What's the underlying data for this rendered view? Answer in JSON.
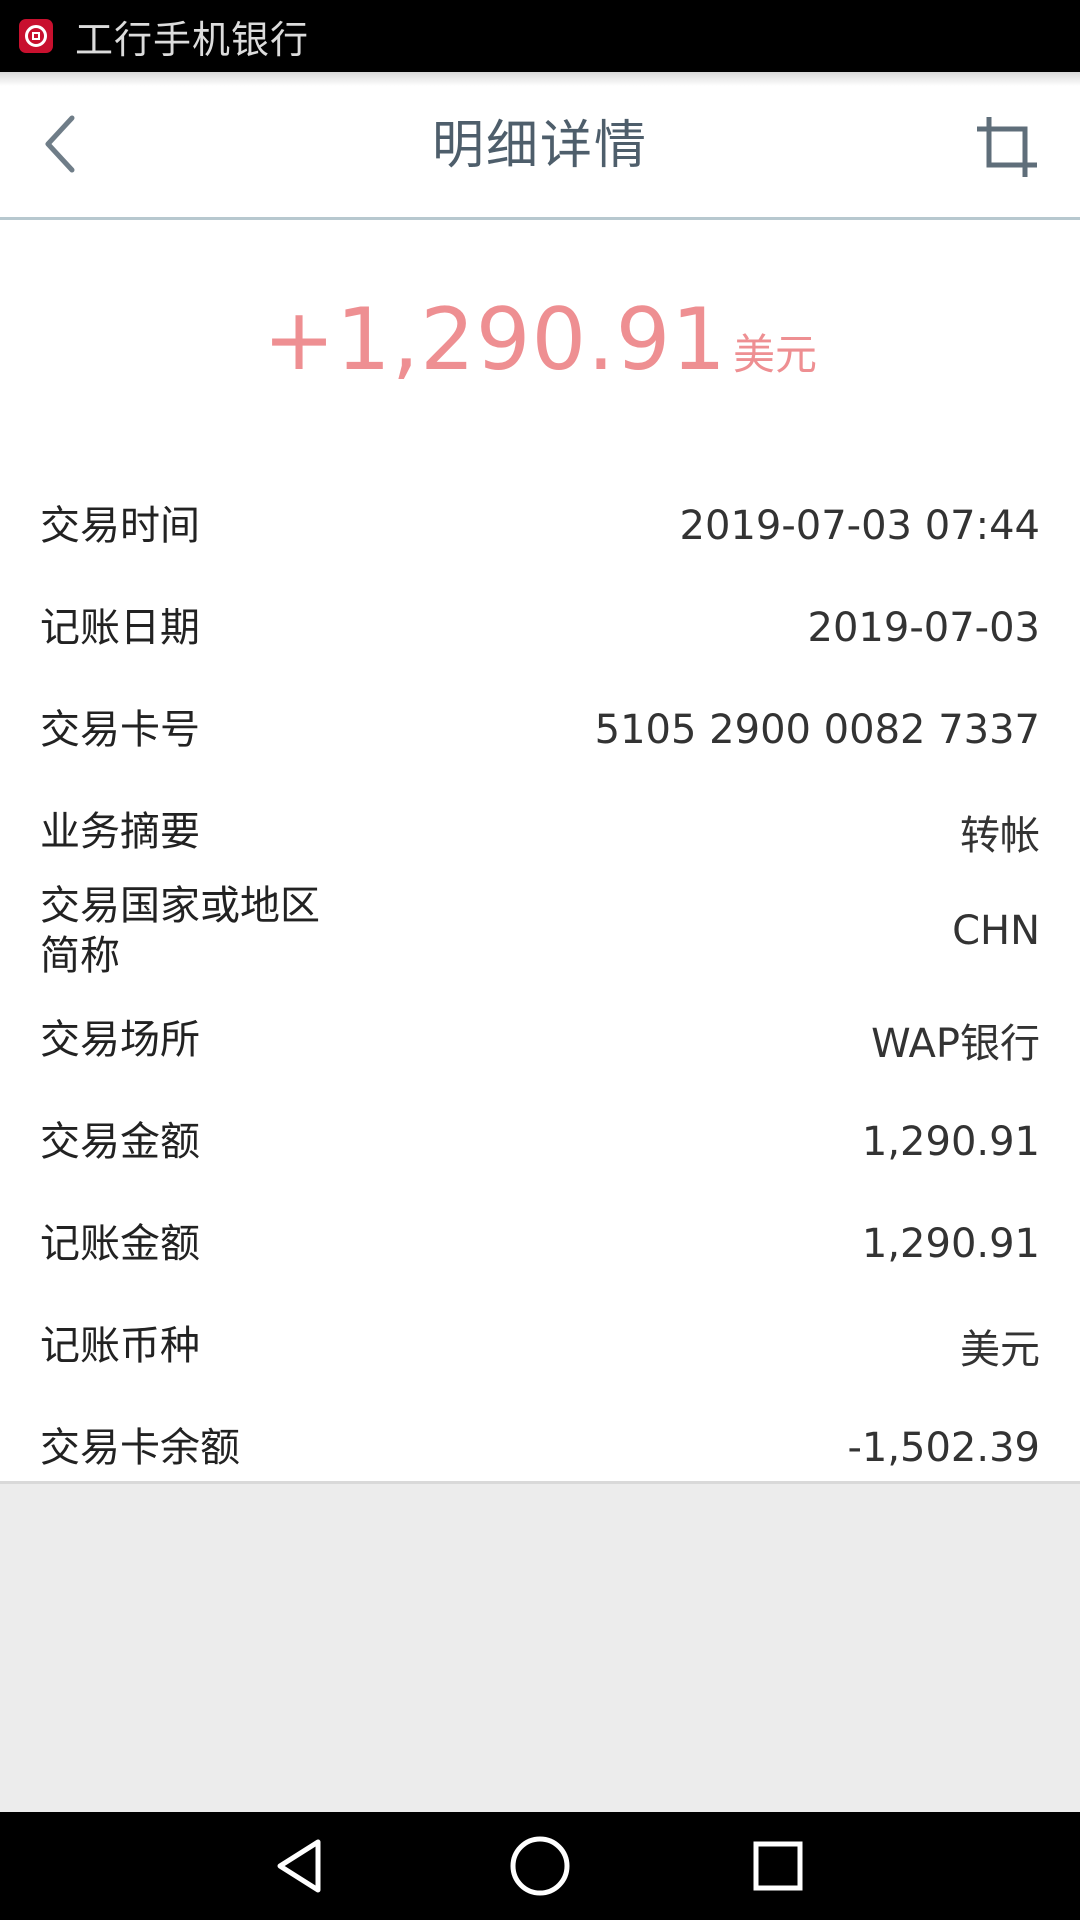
{
  "status_bar": {
    "app_title": "工行手机银行",
    "app_icon": "icbc-logo-icon"
  },
  "header": {
    "title": "明细详情",
    "back_icon": "chevron-left-icon",
    "action_icon": "crop-icon"
  },
  "summary": {
    "amount": "+1,290.91",
    "currency": "美元",
    "amount_color": "#ee8f92"
  },
  "details": [
    {
      "label": "交易时间",
      "value": "2019-07-03 07:44"
    },
    {
      "label": "记账日期",
      "value": "2019-07-03"
    },
    {
      "label": "交易卡号",
      "value": "5105 2900 0082 7337"
    },
    {
      "label": "业务摘要",
      "value": "转帐"
    },
    {
      "label": "交易国家或地区简称",
      "value": "CHN"
    },
    {
      "label": "交易场所",
      "value": "WAP银行"
    },
    {
      "label": "交易金额",
      "value": "1,290.91"
    },
    {
      "label": "记账金额",
      "value": "1,290.91"
    },
    {
      "label": "记账币种",
      "value": "美元"
    },
    {
      "label": "交易卡余额",
      "value": "-1,502.39"
    }
  ],
  "system_nav": {
    "back_icon": "triangle-back-icon",
    "home_icon": "circle-home-icon",
    "recents_icon": "square-recents-icon"
  }
}
